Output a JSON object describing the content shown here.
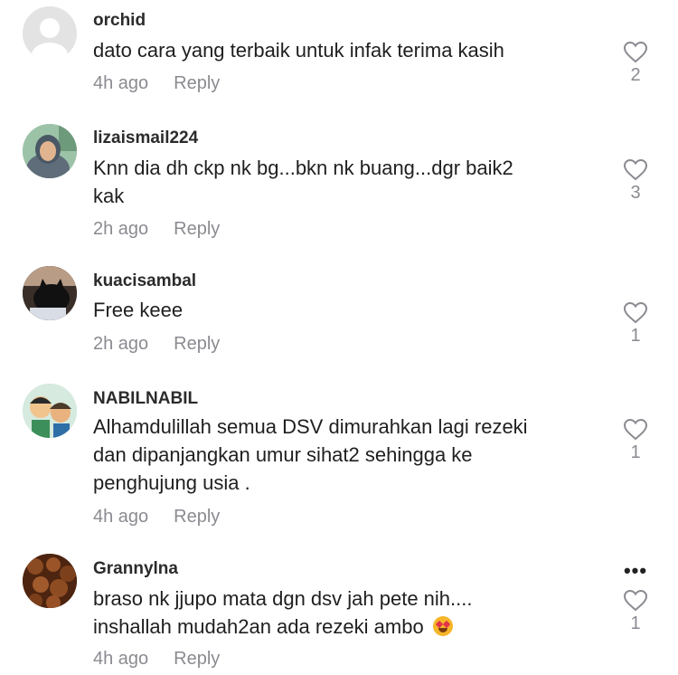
{
  "comments": [
    {
      "username": "orchid",
      "lines": [
        "dato cara yang terbaik untuk infak terima kasih"
      ],
      "time": "4h ago",
      "reply_label": "Reply",
      "likes": "2",
      "avatar": "default-avatar"
    },
    {
      "username": "lizaismail224",
      "lines": [
        "Knn dia dh ckp nk bg...bkn nk buang...dgr baik2",
        "kak"
      ],
      "time": "2h ago",
      "reply_label": "Reply",
      "likes": "3",
      "avatar": "woman-hijab-photo"
    },
    {
      "username": "kuacisambal",
      "lines": [
        "Free keee"
      ],
      "time": "2h ago",
      "reply_label": "Reply",
      "likes": "1",
      "avatar": "cat-photo"
    },
    {
      "username": "NABILNABIL",
      "lines": [
        "Alhamdulillah semua DSV dimurahkan lagi rezeki",
        "dan dipanjangkan umur sihat2 sehingga ke",
        "penghujung usia ."
      ],
      "time": "4h ago",
      "reply_label": "Reply",
      "likes": "1",
      "avatar": "cartoon-kids"
    },
    {
      "username": "Grannylna",
      "lines": [
        "braso nk jjupo mata dgn dsv jah pete nih....",
        "inshallah mudah2an ada rezeki ambo"
      ],
      "time": "4h ago",
      "reply_label": "Reply",
      "likes": "1",
      "avatar": "food-photo",
      "emoji": "heart-eyes-emoji"
    }
  ],
  "more_options_label": "•••",
  "colors": {
    "text": "#161823",
    "meta": "#8a8b91",
    "heart_stroke": "#8a8b91"
  }
}
